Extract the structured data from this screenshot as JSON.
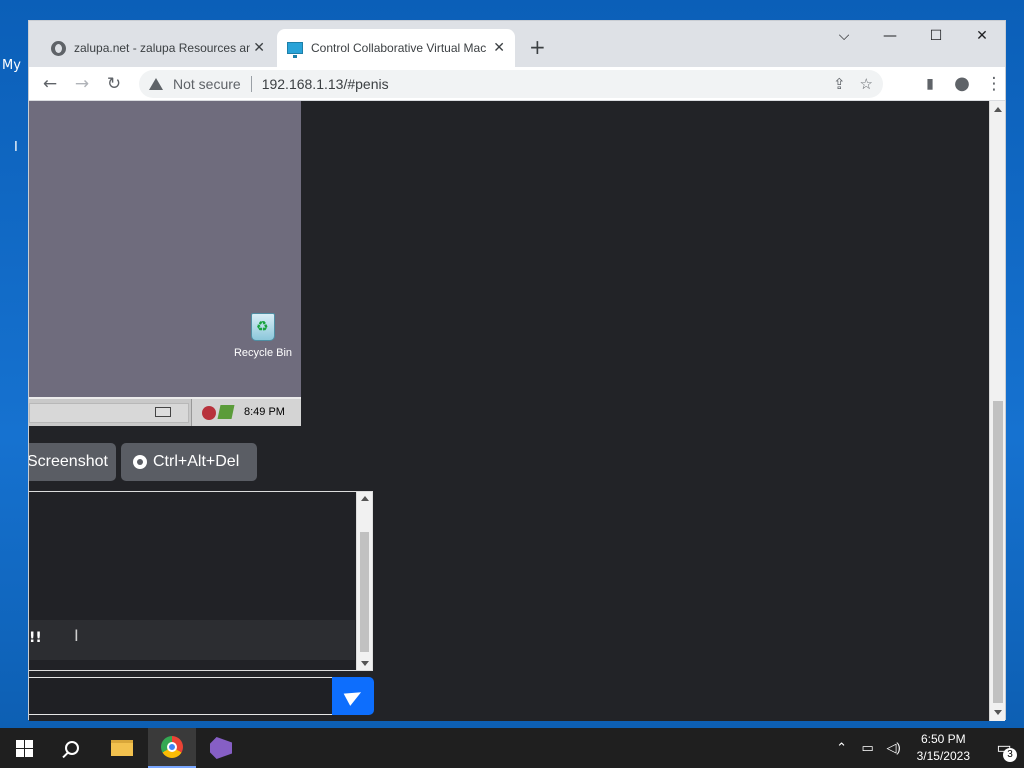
{
  "desktop": {
    "peek_label": "My",
    "peek_label2": "I"
  },
  "browser": {
    "tabs": [
      {
        "title": "zalupa.net - zalupa Resources and",
        "icon": "globe-icon",
        "close": "✕"
      },
      {
        "title": "Control Collaborative Virtual Machine",
        "icon": "monitor-icon",
        "close": "✕"
      }
    ],
    "new_tab": "+",
    "window_controls": {
      "dropdown": "⌵",
      "minimize": "—",
      "maximize": "☐",
      "close": "✕"
    },
    "toolbar": {
      "back": "←",
      "forward": "→",
      "reload": "↻",
      "security_label": "Not secure",
      "url": "192.168.1.13/#penis"
    },
    "omnibox_actions": {
      "share": "⇪",
      "bookmark": "☆",
      "sidepanel": "▮",
      "profile": "●",
      "menu": "⋮"
    }
  },
  "vm": {
    "recycle_bin_label": "Recycle Bin",
    "clock": "8:49 PM"
  },
  "page": {
    "screenshot_label": "Screenshot",
    "cad_label": "Ctrl+Alt+Del",
    "chat_message": "!!",
    "chat_input_value": "",
    "send_icon": "paper-plane-icon"
  },
  "taskbar": {
    "apps": [
      "start-icon",
      "search-icon",
      "file-explorer-icon",
      "chrome-icon",
      "visual-studio-icon"
    ],
    "tray_chevron": "⌃",
    "time": "6:50 PM",
    "date": "3/15/2023",
    "notification_count": "3"
  },
  "colors": {
    "page_bg": "#222327",
    "button_bg": "#5a5d64",
    "send_button": "#0d6efd",
    "taskbar_bg": "#1f1f1f"
  }
}
